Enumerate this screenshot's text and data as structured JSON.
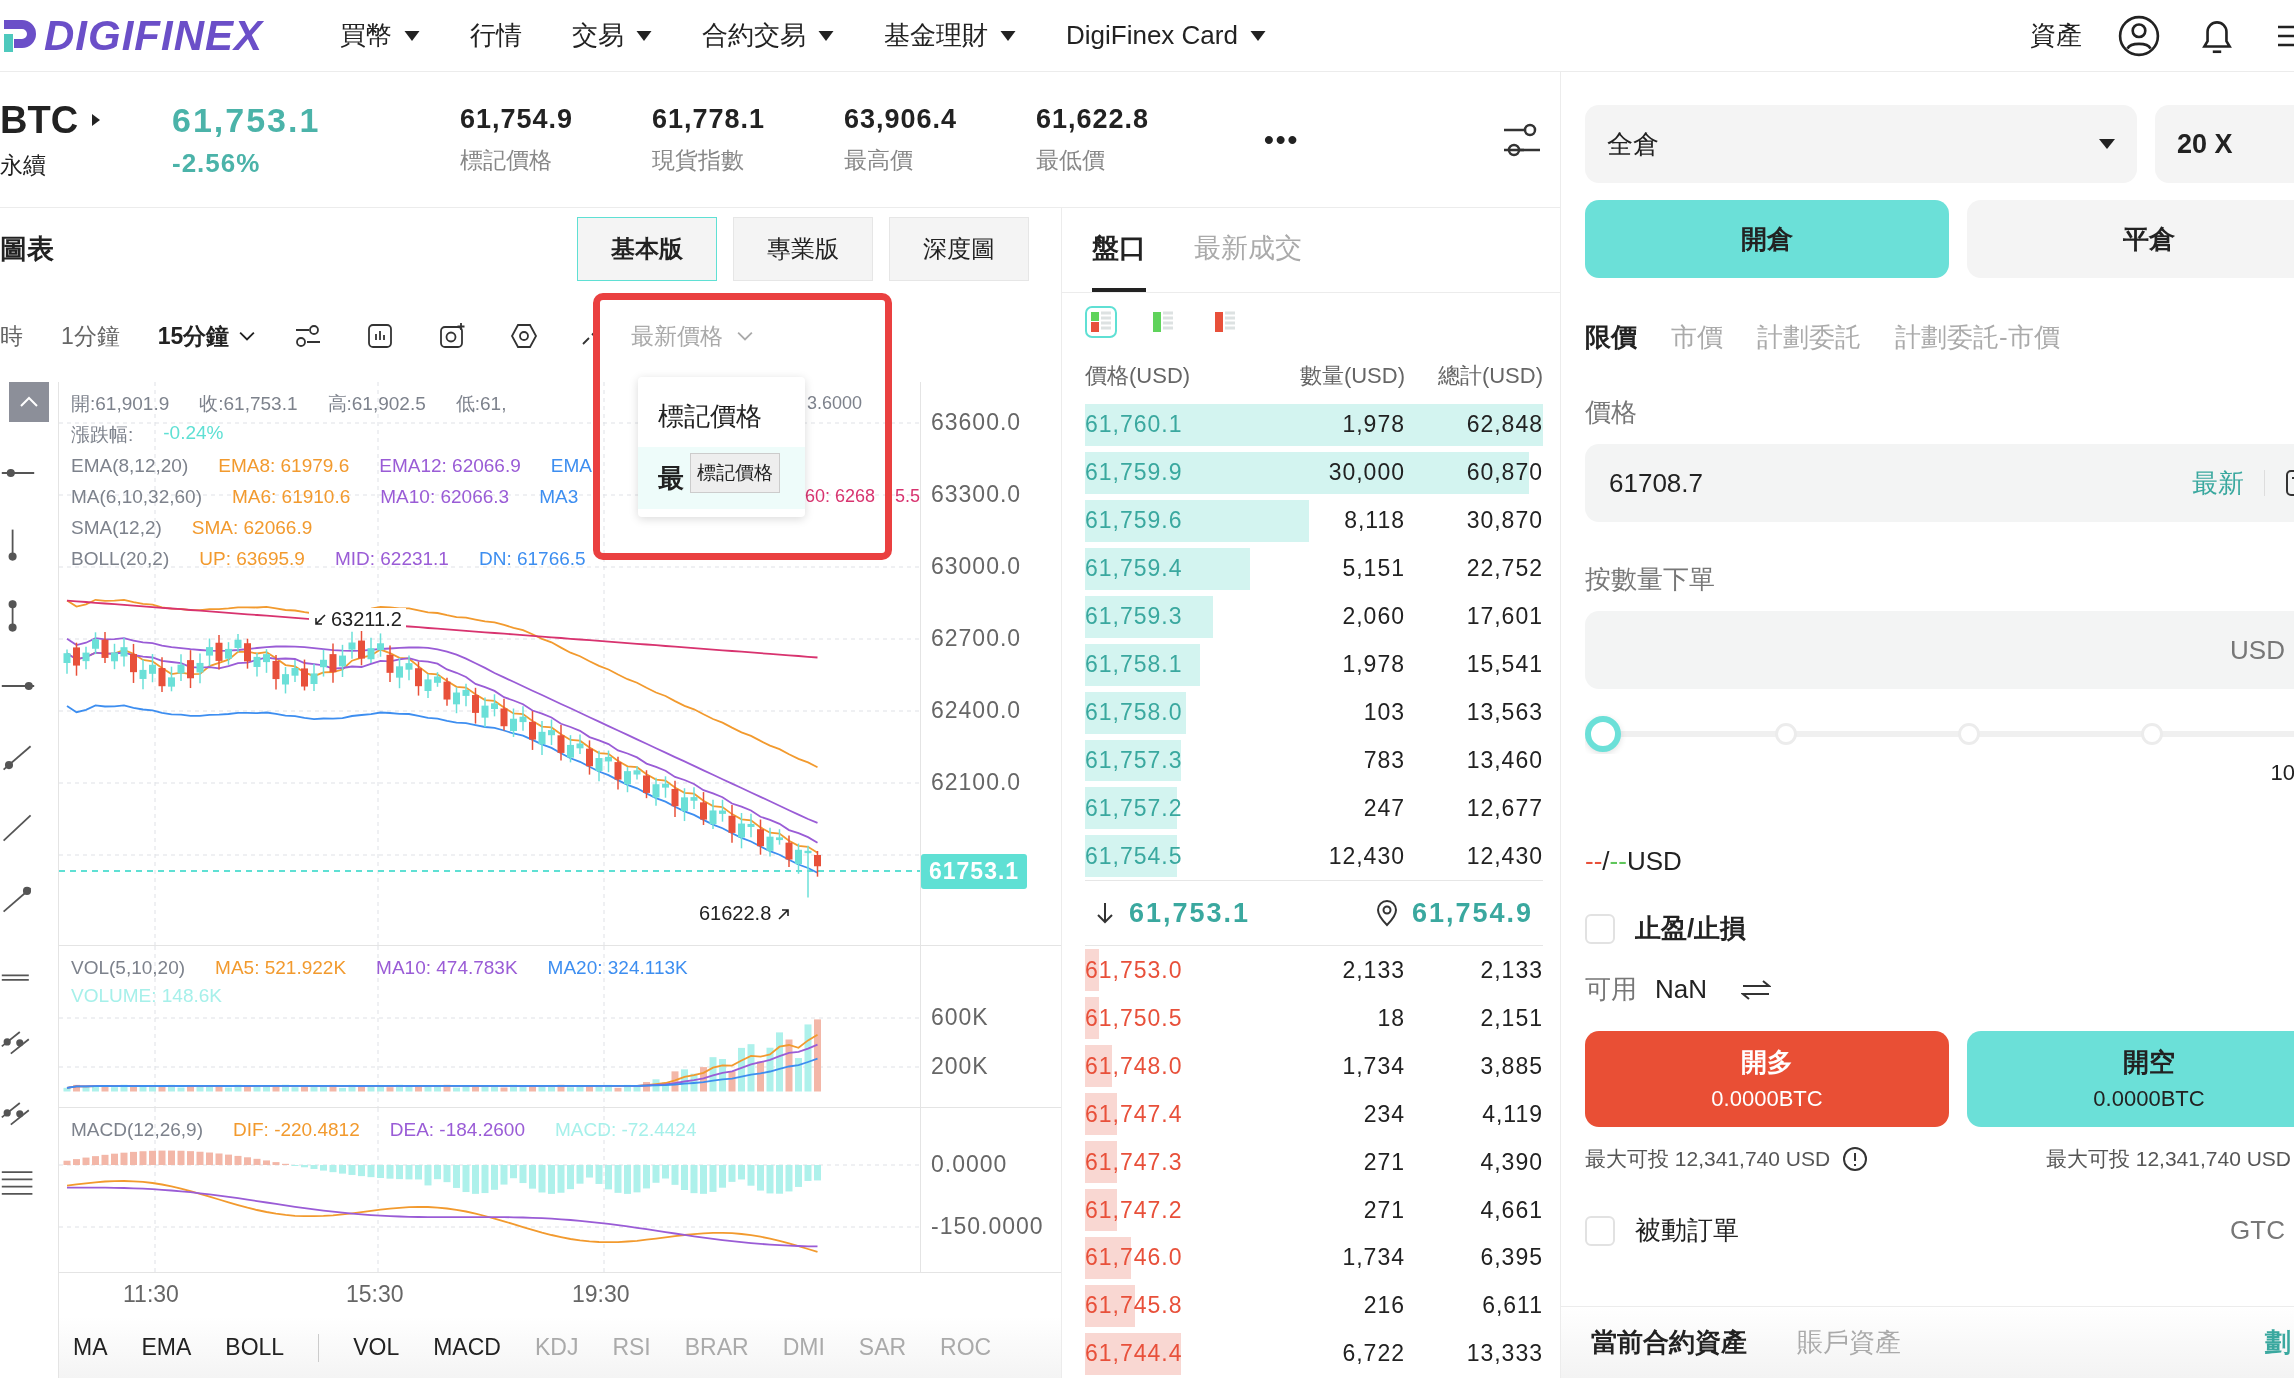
{
  "nav": {
    "logo": "DIGIFINEX",
    "items": [
      {
        "label": "買幣",
        "dropdown": true
      },
      {
        "label": "行情",
        "dropdown": false
      },
      {
        "label": "交易",
        "dropdown": true
      },
      {
        "label": "合約交易",
        "dropdown": true
      },
      {
        "label": "基金理財",
        "dropdown": true
      },
      {
        "label": "DigiFinex Card",
        "dropdown": true
      }
    ],
    "assets": "資產"
  },
  "ticker": {
    "symbol": "BTC",
    "type": "永續",
    "price": "61,753.1",
    "change": "-2.56%",
    "stats": [
      {
        "value": "61,754.9",
        "label": "標記價格"
      },
      {
        "value": "61,778.1",
        "label": "現貨指數"
      },
      {
        "value": "63,906.4",
        "label": "最高價"
      },
      {
        "value": "61,622.8",
        "label": "最低價"
      }
    ],
    "more": "•••"
  },
  "chart": {
    "title": "圖表",
    "views": [
      {
        "label": "基本版",
        "selected": true
      },
      {
        "label": "專業版",
        "selected": false
      },
      {
        "label": "深度圖",
        "selected": false
      }
    ],
    "intervals": [
      {
        "label": "時",
        "selected": false
      },
      {
        "label": "1分鐘",
        "selected": false
      },
      {
        "label": "15分鐘",
        "selected": true
      }
    ],
    "price_source": "最新價格",
    "price_menu": {
      "items": [
        {
          "label": "標記價格",
          "selected": false
        },
        {
          "label": "最",
          "selected": true
        }
      ],
      "tooltip": "標記價格"
    },
    "legend": [
      {
        "items": [
          {
            "text": "開:61,901.9",
            "color": "#7d828c"
          },
          {
            "text": "收:61,753.1",
            "color": "#7d828c"
          },
          {
            "text": "高:61,902.5",
            "color": "#7d828c"
          },
          {
            "text": "低:61,",
            "color": "#7d828c"
          }
        ],
        "beyond_menu": [
          {
            "text": "3.6000",
            "color": "#7d828c"
          }
        ]
      },
      {
        "items": [
          {
            "text": "漲跌幅:",
            "color": "#7d828c"
          },
          {
            "text": "-0.24%",
            "color": "#5fe0d4"
          }
        ]
      },
      {
        "items": [
          {
            "text": "EMA(8,12,20)",
            "color": "#7d828c"
          },
          {
            "text": "EMA8: 61979.6",
            "color": "#f29a2e"
          },
          {
            "text": "EMA12: 62066.9",
            "color": "#9a5cd6"
          },
          {
            "text": "EMA",
            "color": "#3d8ef0"
          }
        ]
      },
      {
        "items": [
          {
            "text": "MA(6,10,32,60)",
            "color": "#7d828c"
          },
          {
            "text": "MA6: 61910.6",
            "color": "#f29a2e"
          },
          {
            "text": "MA10: 62066.3",
            "color": "#9a5cd6"
          },
          {
            "text": "MA3",
            "color": "#3d8ef0"
          }
        ],
        "beyond_menu": [
          {
            "text": "60: 6268",
            "color": "#d8336f"
          }
        ],
        "beyond_frame": [
          {
            "text": "5.5",
            "color": "#d8336f"
          }
        ]
      },
      {
        "items": [
          {
            "text": "SMA(12,2)",
            "color": "#7d828c"
          },
          {
            "text": "SMA: 62066.9",
            "color": "#f29a2e"
          }
        ]
      },
      {
        "items": [
          {
            "text": "BOLL(20,2)",
            "color": "#7d828c"
          },
          {
            "text": "UP: 63695.9",
            "color": "#f29a2e"
          },
          {
            "text": "MID: 62231.1",
            "color": "#9a5cd6"
          },
          {
            "text": "DN: 61766.5",
            "color": "#3d8ef0"
          }
        ]
      }
    ],
    "high_marker": "63211.2",
    "low_marker": "61622.8",
    "last_price_tag": "61753.1",
    "price_axis": [
      "63600.0",
      "63300.0",
      "63000.0",
      "62700.0",
      "62400.0",
      "62100.0"
    ],
    "volume_legend": [
      {
        "items": [
          {
            "text": "VOL(5,10,20)",
            "color": "#7d828c"
          },
          {
            "text": "MA5: 521.922K",
            "color": "#f29a2e"
          },
          {
            "text": "MA10: 474.783K",
            "color": "#9a5cd6"
          },
          {
            "text": "MA20: 324.113K",
            "color": "#3d8ef0"
          }
        ]
      },
      {
        "items": [
          {
            "text": "VOLUME: 148.6K",
            "color": "#a6f0ea"
          }
        ]
      }
    ],
    "volume_axis": [
      "600K",
      "200K"
    ],
    "macd_legend": [
      {
        "items": [
          {
            "text": "MACD(12,26,9)",
            "color": "#7d828c"
          },
          {
            "text": "DIF: -220.4812",
            "color": "#f29a2e"
          },
          {
            "text": "DEA: -184.2600",
            "color": "#9a5cd6"
          },
          {
            "text": "MACD: -72.4424",
            "color": "#a6f0ea"
          }
        ]
      }
    ],
    "macd_axis": [
      "0.0000",
      "-150.0000"
    ],
    "time_axis": [
      "11:30",
      "15:30",
      "19:30"
    ],
    "indicators": {
      "main": [
        {
          "label": "MA",
          "selected": true
        },
        {
          "label": "EMA",
          "selected": true
        },
        {
          "label": "BOLL",
          "selected": true
        }
      ],
      "sub": [
        {
          "label": "VOL",
          "selected": true
        },
        {
          "label": "MACD",
          "selected": true
        },
        {
          "label": "KDJ",
          "selected": false
        },
        {
          "label": "RSI",
          "selected": false
        },
        {
          "label": "BRAR",
          "selected": false
        },
        {
          "label": "DMI",
          "selected": false
        },
        {
          "label": "SAR",
          "selected": false
        },
        {
          "label": "ROC",
          "selected": false
        }
      ]
    }
  },
  "book": {
    "tabs": [
      {
        "label": "盤口",
        "selected": true
      },
      {
        "label": "最新成交",
        "selected": false
      }
    ],
    "views": [
      {
        "selected": true
      },
      {
        "selected": false
      },
      {
        "selected": false
      }
    ],
    "columns": [
      "價格(USD)",
      "數量(USD)",
      "總計(USD)"
    ],
    "asks": [
      {
        "price": "61,760.1",
        "amount": "1,978",
        "total": "62,848",
        "level": 1.0
      },
      {
        "price": "61,759.9",
        "amount": "30,000",
        "total": "60,870",
        "level": 0.97
      },
      {
        "price": "61,759.6",
        "amount": "8,118",
        "total": "30,870",
        "level": 0.49
      },
      {
        "price": "61,759.4",
        "amount": "5,151",
        "total": "22,752",
        "level": 0.36
      },
      {
        "price": "61,759.3",
        "amount": "2,060",
        "total": "17,601",
        "level": 0.28
      },
      {
        "price": "61,758.1",
        "amount": "1,978",
        "total": "15,541",
        "level": 0.25
      },
      {
        "price": "61,758.0",
        "amount": "103",
        "total": "13,563",
        "level": 0.22
      },
      {
        "price": "61,757.3",
        "amount": "783",
        "total": "13,460",
        "level": 0.21
      },
      {
        "price": "61,757.2",
        "amount": "247",
        "total": "12,677",
        "level": 0.2
      },
      {
        "price": "61,754.5",
        "amount": "12,430",
        "total": "12,430",
        "level": 0.2
      }
    ],
    "last_price": "61,753.1",
    "mark_price": "61,754.9",
    "bids": [
      {
        "price": "61,753.0",
        "amount": "2,133",
        "total": "2,133",
        "level": 0.03
      },
      {
        "price": "61,750.5",
        "amount": "18",
        "total": "2,151",
        "level": 0.03
      },
      {
        "price": "61,748.0",
        "amount": "1,734",
        "total": "3,885",
        "level": 0.06
      },
      {
        "price": "61,747.4",
        "amount": "234",
        "total": "4,119",
        "level": 0.07
      },
      {
        "price": "61,747.3",
        "amount": "271",
        "total": "4,390",
        "level": 0.07
      },
      {
        "price": "61,747.2",
        "amount": "271",
        "total": "4,661",
        "level": 0.07
      },
      {
        "price": "61,746.0",
        "amount": "1,734",
        "total": "6,395",
        "level": 0.1
      },
      {
        "price": "61,745.8",
        "amount": "216",
        "total": "6,611",
        "level": 0.11
      },
      {
        "price": "61,744.4",
        "amount": "6,722",
        "total": "13,333",
        "level": 0.21
      }
    ]
  },
  "order": {
    "margin_mode": "全倉",
    "leverage": "20 X",
    "sides": [
      {
        "label": "開倉",
        "selected": true
      },
      {
        "label": "平倉",
        "selected": false
      }
    ],
    "types": [
      {
        "label": "限價",
        "selected": true
      },
      {
        "label": "市價",
        "selected": false
      },
      {
        "label": "計劃委託",
        "selected": false
      },
      {
        "label": "計劃委託-市價",
        "selected": false
      }
    ],
    "price_label": "價格",
    "price_value": "61708.7",
    "latest": "最新",
    "qty_label": "按數量下單",
    "qty_unit": "USD",
    "slider": {
      "level": 0,
      "end_label": "10"
    },
    "cost_sell": "--",
    "cost_sep": "/",
    "cost_buy": "--",
    "cost_unit": "USD",
    "tpsl": {
      "label": "止盈/止損",
      "checked": false
    },
    "available_label": "可用",
    "available_value": "NaN",
    "buy": {
      "label": "開多",
      "amount": "0.0000BTC"
    },
    "sell": {
      "label": "開空",
      "amount": "0.0000BTC"
    },
    "max_long": "最大可投 12,341,740 USD",
    "max_short": "最大可投 12,341,740 USD",
    "post_only": {
      "label": "被動訂單",
      "checked": false
    },
    "tif": "GTC",
    "bottom_tabs": [
      {
        "label": "當前合約資產",
        "selected": true
      },
      {
        "label": "賬戶資產",
        "selected": false
      }
    ],
    "transfer": "劃"
  }
}
